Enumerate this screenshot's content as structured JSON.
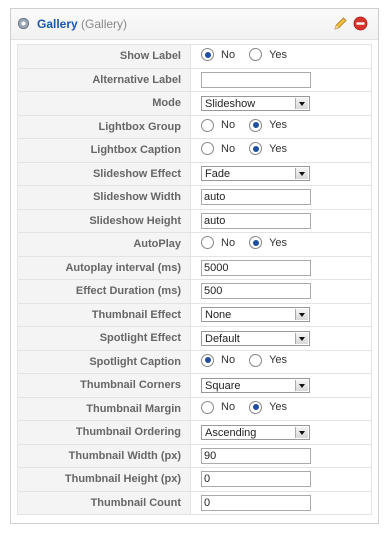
{
  "header": {
    "title": "Gallery",
    "subtitle": "(Gallery)"
  },
  "colors": {
    "title": "#1b57b1",
    "delete": "#d9322c",
    "edit": "#e8a91d"
  },
  "icons": {
    "module": "gear-icon",
    "edit": "pencil-icon",
    "delete": "delete-icon"
  },
  "params": [
    {
      "label": "Show Label",
      "type": "radio",
      "options": [
        "No",
        "Yes"
      ],
      "selected": 0
    },
    {
      "label": "Alternative Label",
      "type": "text",
      "value": ""
    },
    {
      "label": "Mode",
      "type": "select",
      "value": "Slideshow"
    },
    {
      "label": "Lightbox Group",
      "type": "radio",
      "options": [
        "No",
        "Yes"
      ],
      "selected": 1
    },
    {
      "label": "Lightbox Caption",
      "type": "radio",
      "options": [
        "No",
        "Yes"
      ],
      "selected": 1
    },
    {
      "label": "Slideshow Effect",
      "type": "select",
      "value": "Fade"
    },
    {
      "label": "Slideshow Width",
      "type": "text",
      "value": "auto"
    },
    {
      "label": "Slideshow Height",
      "type": "text",
      "value": "auto"
    },
    {
      "label": "AutoPlay",
      "type": "radio",
      "options": [
        "No",
        "Yes"
      ],
      "selected": 1
    },
    {
      "label": "Autoplay interval (ms)",
      "type": "text",
      "value": "5000"
    },
    {
      "label": "Effect Duration (ms)",
      "type": "text",
      "value": "500"
    },
    {
      "label": "Thumbnail Effect",
      "type": "select",
      "value": "None"
    },
    {
      "label": "Spotlight Effect",
      "type": "select",
      "value": "Default"
    },
    {
      "label": "Spotlight Caption",
      "type": "radio",
      "options": [
        "No",
        "Yes"
      ],
      "selected": 0
    },
    {
      "label": "Thumbnail Corners",
      "type": "select",
      "value": "Square"
    },
    {
      "label": "Thumbnail Margin",
      "type": "radio",
      "options": [
        "No",
        "Yes"
      ],
      "selected": 1
    },
    {
      "label": "Thumbnail Ordering",
      "type": "select",
      "value": "Ascending"
    },
    {
      "label": "Thumbnail Width (px)",
      "type": "text",
      "value": "90"
    },
    {
      "label": "Thumbnail Height (px)",
      "type": "text",
      "value": "0"
    },
    {
      "label": "Thumbnail Count",
      "type": "text",
      "value": "0"
    }
  ]
}
